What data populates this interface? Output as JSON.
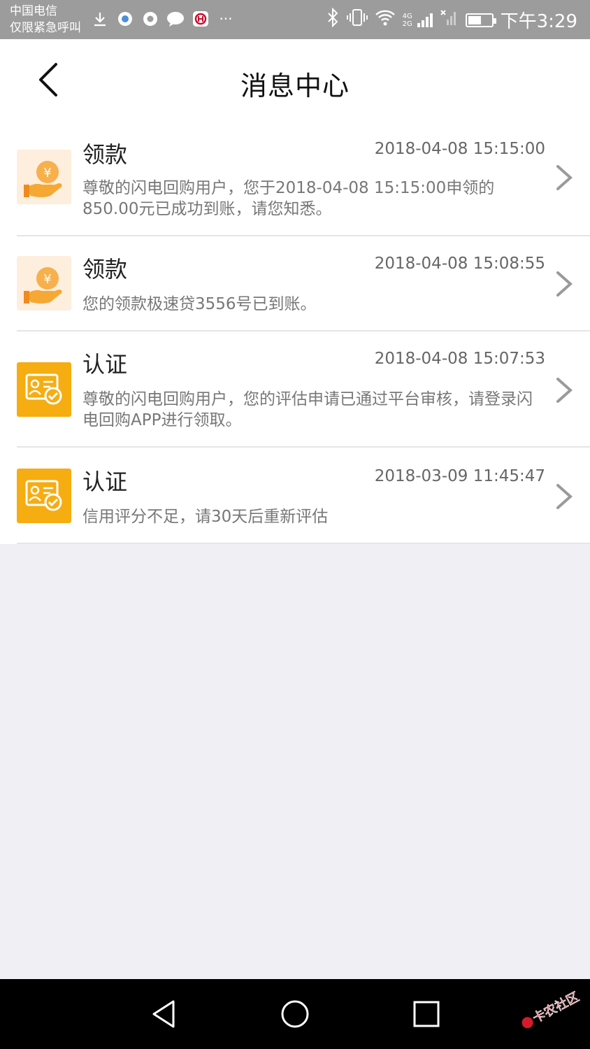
{
  "status_bar": {
    "carrier_line1": "中国电信",
    "carrier_line2": "仅限紧急呼叫",
    "time": "下午3:29",
    "more": "···",
    "network": "4G 2G",
    "battery_level": 0.55
  },
  "header": {
    "title": "消息中心"
  },
  "messages": [
    {
      "type": "money",
      "title": "领款",
      "time": "2018-04-08 15:15:00",
      "body": "尊敬的闪电回购用户，您于2018-04-08 15:15:00申领的850.00元已成功到账，请您知悉。"
    },
    {
      "type": "money",
      "title": "领款",
      "time": "2018-04-08 15:08:55",
      "body": "您的领款极速贷3556号已到账。"
    },
    {
      "type": "cert",
      "title": "认证",
      "time": "2018-04-08 15:07:53",
      "body": "尊敬的闪电回购用户，您的评估申请已通过平台审核，请登录闪电回购APP进行领取。"
    },
    {
      "type": "cert",
      "title": "认证",
      "time": "2018-03-09 11:45:47",
      "body": "信用评分不足，请30天后重新评估"
    }
  ],
  "watermark": "卡农社区",
  "colors": {
    "cert_icon_bg": "#f6ad12",
    "money_icon_bg": "#fdeedd",
    "money_icon_accent": "#f5a833",
    "page_bg": "#efeff4"
  }
}
